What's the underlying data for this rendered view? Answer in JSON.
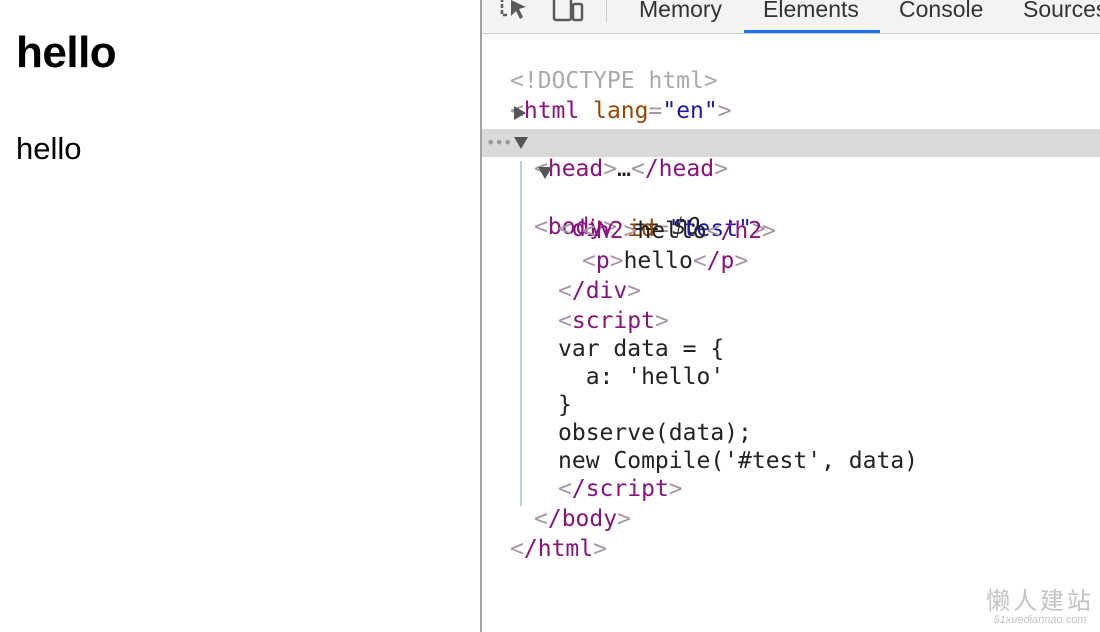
{
  "page": {
    "h2": "hello",
    "p": "hello"
  },
  "devtools": {
    "tabs": [
      "Memory",
      "Elements",
      "Console",
      "Sources"
    ],
    "active_tab": "Elements",
    "icons": [
      "inspect-element-icon",
      "device-toolbar-icon"
    ]
  },
  "dom": {
    "doctype": "<!DOCTYPE html>",
    "html_open": {
      "tag": "html",
      "attr": "lang",
      "value": "\"en\""
    },
    "head": {
      "open": "head",
      "ellipsis": "…",
      "close": "/head"
    },
    "body": {
      "open": "body",
      "suffix": "== $0"
    },
    "div": {
      "tag": "div",
      "attr": "id",
      "value": "\"test\""
    },
    "h2": {
      "tag": "h2",
      "text": "hello",
      "close": "/h2"
    },
    "p": {
      "tag": "p",
      "text": "hello",
      "close": "/p"
    },
    "div_close": "/div",
    "script_open": "script",
    "script_lines": [
      "var data = {",
      "  a: 'hello'",
      "}",
      "observe(data);",
      "new Compile('#test', data)"
    ],
    "script_close": "/script",
    "body_close": "/body",
    "html_close": "/html"
  },
  "watermark": {
    "main": "懒人建站",
    "sub": "51xuediannao.com"
  },
  "colors": {
    "tag": "#881280",
    "attr": "#994500",
    "value": "#1a1aa6",
    "selected_row": "#d9d9d9",
    "active_tab_underline": "#1a73e8"
  }
}
